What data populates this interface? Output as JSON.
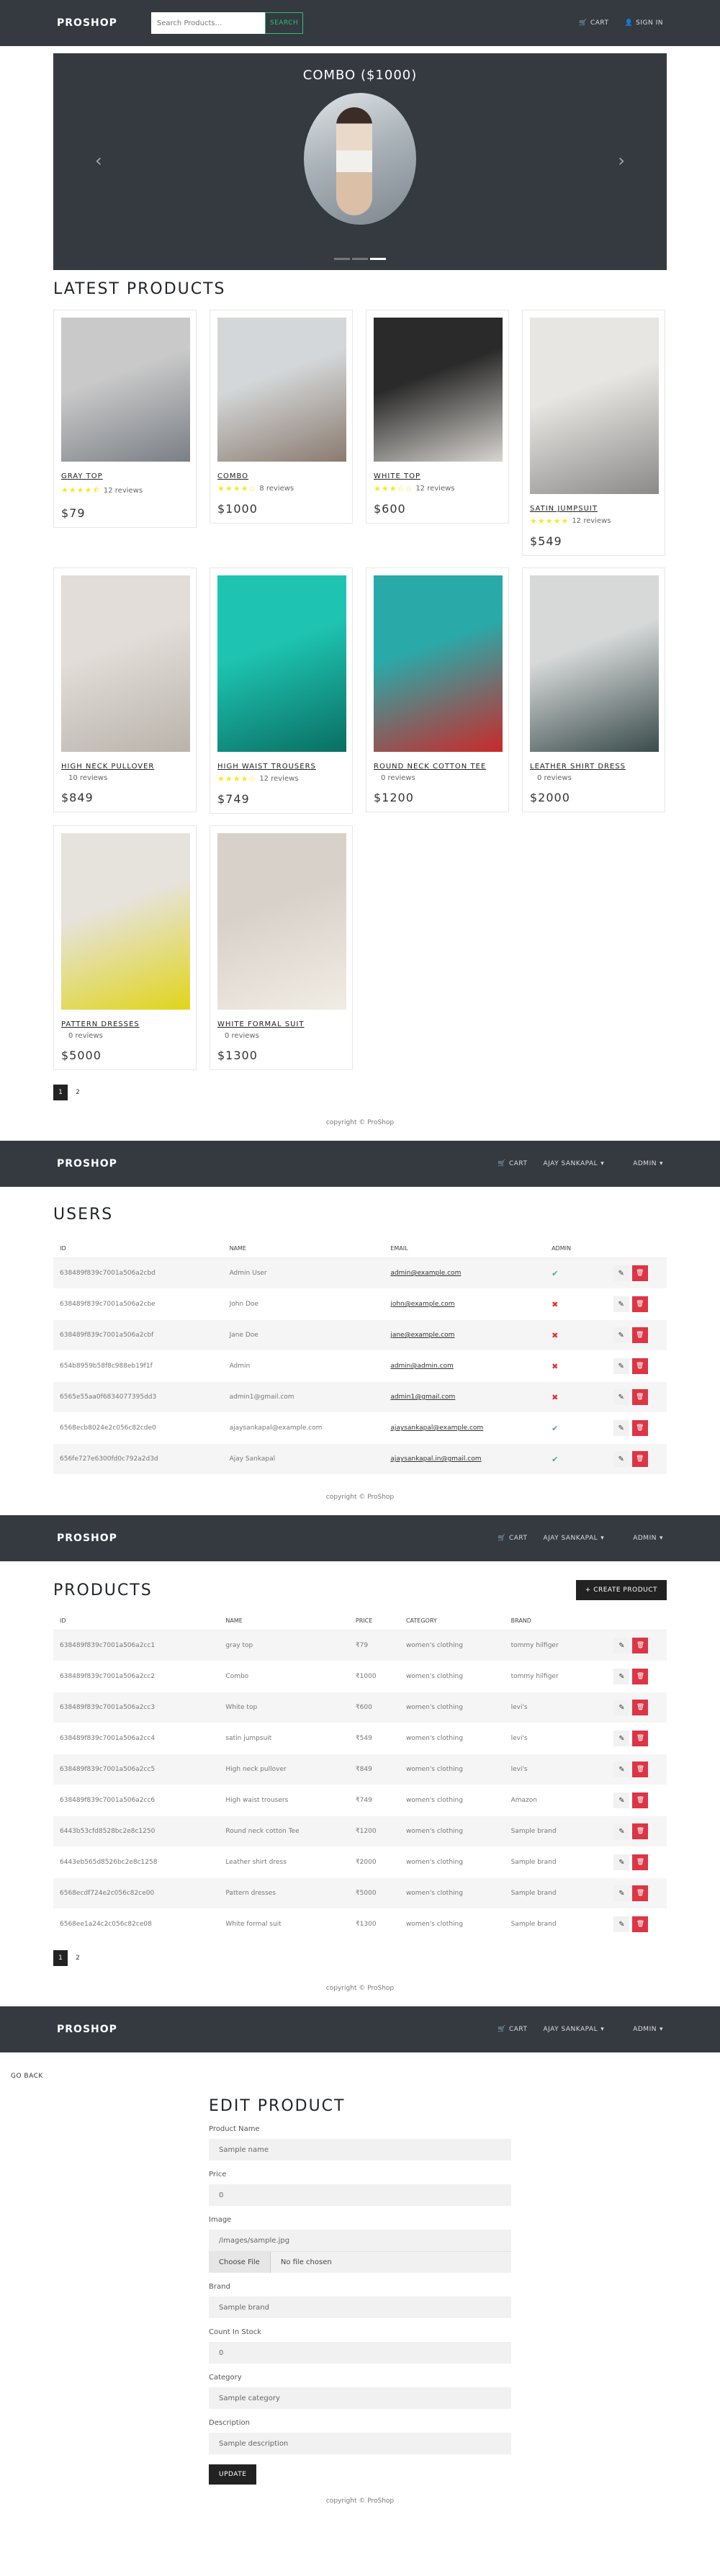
{
  "brand": "PROSHOP",
  "nav": {
    "search_placeholder": "Search Products...",
    "search_button": "SEARCH",
    "cart": "CART",
    "sign_in": "SIGN IN",
    "user": "AJAY SANKAPAL",
    "admin": "ADMIN"
  },
  "carousel": {
    "title": "COMBO ($1000)",
    "slides": 3,
    "active_slide": 2
  },
  "home": {
    "title": "LATEST PRODUCTS",
    "products": [
      {
        "name": "GRAY TOP",
        "rating": 4.5,
        "reviews": "12 reviews",
        "price": "$79",
        "colors": [
          "#c9c9c9",
          "#7a7f86"
        ]
      },
      {
        "name": "COMBO",
        "rating": 4,
        "reviews": "8 reviews",
        "price": "$1000",
        "colors": [
          "#d4d7d9",
          "#8a7b6f"
        ]
      },
      {
        "name": "WHITE TOP",
        "rating": 3,
        "reviews": "12 reviews",
        "price": "$600",
        "colors": [
          "#2a2a2a",
          "#d9d5d0"
        ]
      },
      {
        "name": "SATIN JUMPSUIT",
        "rating": 5,
        "reviews": "12 reviews",
        "price": "$549",
        "colors": [
          "#e8e6e3",
          "#8c8a88"
        ]
      },
      {
        "name": "HIGH NECK PULLOVER",
        "rating": 0,
        "reviews": "10 reviews",
        "price": "$849",
        "colors": [
          "#e2ddd8",
          "#b9b3ab"
        ]
      },
      {
        "name": "HIGH WAIST TROUSERS",
        "rating": 4,
        "reviews": "12 reviews",
        "price": "$749",
        "colors": [
          "#1ec4b1",
          "#0a6e63"
        ]
      },
      {
        "name": "ROUND NECK COTTON TEE",
        "rating": 0,
        "reviews": "0 reviews",
        "price": "$1200",
        "colors": [
          "#2aa9a9",
          "#c92a2a"
        ]
      },
      {
        "name": "LEATHER SHIRT DRESS",
        "rating": 0,
        "reviews": "0 reviews",
        "price": "$2000",
        "colors": [
          "#d7d9d9",
          "#3a4b4b"
        ]
      },
      {
        "name": "PATTERN DRESSES",
        "rating": 0,
        "reviews": "0 reviews",
        "price": "$5000",
        "colors": [
          "#e6e3dd",
          "#e0d51a"
        ]
      },
      {
        "name": "WHITE FORMAL SUIT",
        "rating": 0,
        "reviews": "0 reviews",
        "price": "$1300",
        "colors": [
          "#d8d1c9",
          "#f1ece4"
        ]
      }
    ],
    "pages": [
      "1",
      "2"
    ]
  },
  "footer": "copyright © ProShop",
  "users": {
    "title": "USERS",
    "columns": [
      "ID",
      "NAME",
      "EMAIL",
      "ADMIN"
    ],
    "rows": [
      {
        "id": "638489f839c7001a506a2cbd",
        "name": "Admin User",
        "email": "admin@example.com",
        "admin": true,
        "link": true
      },
      {
        "id": "638489f839c7001a506a2cbe",
        "name": "John Doe",
        "email": "john@example.com",
        "admin": false,
        "link": true
      },
      {
        "id": "638489f839c7001a506a2cbf",
        "name": "Jane Doe",
        "email": "jane@example.com",
        "admin": false,
        "link": true
      },
      {
        "id": "654b8959b58f8c988eb19f1f",
        "name": "Admin",
        "email": "admin@admin.com",
        "admin": false,
        "link": true
      },
      {
        "id": "6565e55aa0f6834077395dd3",
        "name": "admin1@gmail.com",
        "email": "admin1@gmail.com",
        "admin": false,
        "link": true
      },
      {
        "id": "6568ecb8024e2c056c82cde0",
        "name": "ajaysankapal@example.com",
        "email": "ajaysankapal@example.com",
        "admin": true,
        "link": true
      },
      {
        "id": "656fe727e6300fd0c792a2d3d",
        "name": "Ajay Sankapal",
        "email": "ajaysankapal.in@gmail.com",
        "admin": true,
        "link": true
      }
    ]
  },
  "products": {
    "title": "PRODUCTS",
    "create_button": "+ CREATE PRODUCT",
    "columns": [
      "ID",
      "NAME",
      "PRICE",
      "CATEGORY",
      "BRAND"
    ],
    "rows": [
      {
        "id": "638489f839c7001a506a2cc1",
        "name": "gray top",
        "price": "₹79",
        "category": "women's clothing",
        "brand": "tommy hilfiger"
      },
      {
        "id": "638489f839c7001a506a2cc2",
        "name": "Combo",
        "price": "₹1000",
        "category": "women's clothing",
        "brand": "tommy hilfiger"
      },
      {
        "id": "638489f839c7001a506a2cc3",
        "name": "White top",
        "price": "₹600",
        "category": "women's clothing",
        "brand": "levi's"
      },
      {
        "id": "638489f839c7001a506a2cc4",
        "name": "satin jumpsuit",
        "price": "₹549",
        "category": "women's clothing",
        "brand": "levi's"
      },
      {
        "id": "638489f839c7001a506a2cc5",
        "name": "High neck pullover",
        "price": "₹849",
        "category": "women's clothing",
        "brand": "levi's"
      },
      {
        "id": "638489f839c7001a506a2cc6",
        "name": "High waist trousers",
        "price": "₹749",
        "category": "women's clothing",
        "brand": "Amazon"
      },
      {
        "id": "6443b53cfd8528bc2e8c1250",
        "name": "Round neck cotton Tee",
        "price": "₹1200",
        "category": "women's clothing",
        "brand": "Sample brand"
      },
      {
        "id": "6443eb565d8526bc2e8c1258",
        "name": "Leather shirt dress",
        "price": "₹2000",
        "category": "women's clothing",
        "brand": "Sample brand"
      },
      {
        "id": "6568ecdf724e2c056c82ce00",
        "name": "Pattern dresses",
        "price": "₹5000",
        "category": "women's clothing",
        "brand": "Sample brand"
      },
      {
        "id": "6568ee1a24c2c056c82ce08",
        "name": "White formal suit",
        "price": "₹1300",
        "category": "women's clothing",
        "brand": "Sample brand"
      }
    ],
    "pages": [
      "1",
      "2"
    ]
  },
  "edit": {
    "go_back": "GO BACK",
    "title": "EDIT PRODUCT",
    "name_label": "Product Name",
    "name_value": "Sample name",
    "price_label": "Price",
    "price_value": "0",
    "image_label": "Image",
    "image_value": "/images/sample.jpg",
    "choose_file": "Choose File",
    "no_file": "No file chosen",
    "brand_label": "Brand",
    "brand_value": "Sample brand",
    "stock_label": "Count In Stock",
    "stock_value": "0",
    "category_label": "Category",
    "category_value": "Sample category",
    "description_label": "Description",
    "description_value": "Sample description",
    "update_button": "UPDATE"
  }
}
